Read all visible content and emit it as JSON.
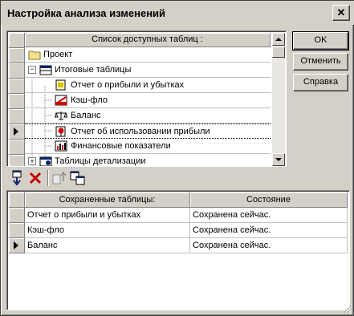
{
  "window": {
    "title": "Настройка анализа изменений",
    "close_glyph": "✕"
  },
  "tables_grid": {
    "header": "Список доступных таблиц :",
    "rows": [
      {
        "label": "Проект",
        "icon": "folder-icon"
      },
      {
        "label": "Итоговые таблицы",
        "icon": "table-group-icon",
        "expander": "−"
      },
      {
        "label": "Отчет о прибыли и убытках",
        "icon": "report-icon"
      },
      {
        "label": "Кэш-фло",
        "icon": "cash-flow-chart-icon"
      },
      {
        "label": "Баланс",
        "icon": "balance-scale-icon"
      },
      {
        "label": "Отчет об использовании прибыли",
        "icon": "profit-usage-icon"
      },
      {
        "label": "Финансовые показатели",
        "icon": "bar-chart-icon"
      },
      {
        "label": "Таблицы детализации",
        "icon": "detail-tables-icon",
        "expander": "+"
      }
    ],
    "selected_row_index": 5
  },
  "buttons": {
    "ok": "OK",
    "cancel": "Отменить",
    "help": "Справка"
  },
  "toolbar": {
    "icons": [
      "add-table-icon",
      "delete-icon",
      "move-up-icon",
      "copy-icon"
    ]
  },
  "saved_grid": {
    "columns": [
      "Сохраненные таблицы:",
      "Состояние"
    ],
    "rows": [
      [
        "Отчет о прибыли и убытках",
        "Сохранена сейчас."
      ],
      [
        "Кэш-фло",
        "Сохранена сейчас."
      ],
      [
        "Баланс",
        "Сохранена сейчас."
      ]
    ],
    "selected_row_index": 2
  }
}
